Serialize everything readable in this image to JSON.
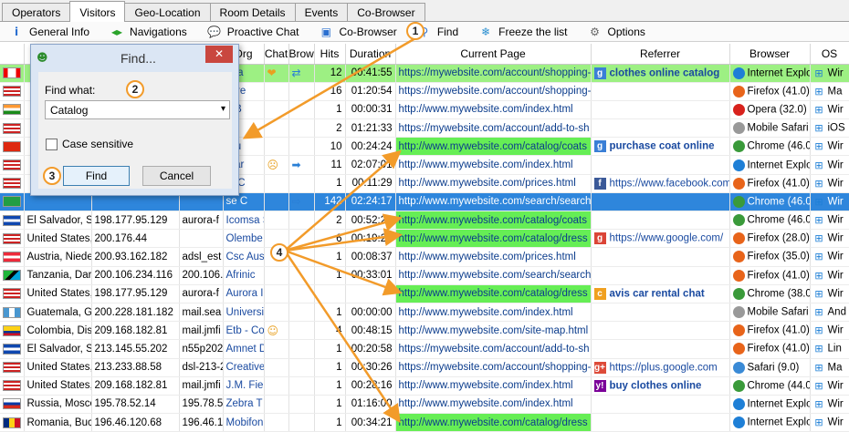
{
  "tabs": [
    "Operators",
    "Visitors",
    "Geo-Location",
    "Room Details",
    "Events",
    "Co-Browser"
  ],
  "active_tab": 1,
  "toolbar": [
    {
      "label": "General Info",
      "icon": "info-icon",
      "glyph": "i",
      "color": "#2a6fd0"
    },
    {
      "label": "Navigations",
      "icon": "navigation-arrows-icon",
      "glyph": "◂▸",
      "color": "#29a329"
    },
    {
      "label": "Proactive Chat",
      "icon": "chat-bubble-icon",
      "glyph": "💬",
      "color": "#e8a020"
    },
    {
      "label": "Co-Browser",
      "icon": "co-browser-icon",
      "glyph": "▣",
      "color": "#2a6fd0"
    },
    {
      "label": "Find",
      "icon": "magnifier-icon",
      "glyph": "⚲",
      "color": "#2a6fd0"
    },
    {
      "label": "Freeze the list",
      "icon": "snowflake-icon",
      "glyph": "❄",
      "color": "#2a8fd0"
    },
    {
      "label": "Options",
      "icon": "gear-icon",
      "glyph": "⚙",
      "color": "#666"
    }
  ],
  "columns": [
    "L",
    "IP",
    "Host",
    "Org",
    "Chat",
    "Brow",
    "Hits",
    "Duration",
    "Current Page",
    "Referrer",
    "Browser",
    "OS"
  ],
  "rows": [
    {
      "flag": "ca",
      "loc": "",
      "ip": "",
      "host": "",
      "org": "affa",
      "chat": "❤",
      "brow": "⇄",
      "hits": "12",
      "dur": "00:41:55",
      "page": "https://mywebsite.com/account/shopping-",
      "hl": false,
      "ref": "clothes online catalog",
      "refico": "g",
      "browser": "Internet Explo",
      "bcol": "#1e7fd6",
      "os": "Wir",
      "style": "green"
    },
    {
      "flag": "us",
      "loc": "",
      "ip": "",
      "host": "",
      "org": "istre",
      "chat": "",
      "brow": "",
      "hits": "16",
      "dur": "01:20:54",
      "page": "https://mywebsite.com/account/shopping-",
      "hl": false,
      "ref": "",
      "refico": "",
      "browser": "Firefox (41.0)",
      "bcol": "#e8641a",
      "os": "Ma",
      "style": ""
    },
    {
      "flag": "in",
      "loc": "",
      "ip": "",
      "host": "",
      "org": "h B",
      "chat": "",
      "brow": "",
      "hits": "1",
      "dur": "00:00:31",
      "page": "http://www.mywebsite.com/index.html",
      "hl": false,
      "ref": "",
      "refico": "",
      "browser": "Opera (32.0)",
      "bcol": "#d8221c",
      "os": "Wir",
      "style": ""
    },
    {
      "flag": "us",
      "loc": "",
      "ip": "",
      "host": "",
      "org": "I",
      "chat": "",
      "brow": "",
      "hits": "2",
      "dur": "01:21:33",
      "page": "https://mywebsite.com/account/add-to-sh",
      "hl": false,
      "ref": "",
      "refico": "",
      "browser": "Mobile Safari",
      "bcol": "#999",
      "os": "iOS",
      "style": ""
    },
    {
      "flag": "cn",
      "loc": "",
      "ip": "",
      "host": "",
      "org": "rou",
      "chat": "",
      "brow": "",
      "hits": "10",
      "dur": "00:24:24",
      "page": "http://www.mywebsite.com/catalog/coats",
      "hl": true,
      "ref": "purchase coat online",
      "refico": "g",
      "browser": "Chrome (46.0",
      "bcol": "#3a9a3a",
      "os": "Wir",
      "style": ""
    },
    {
      "flag": "us",
      "loc": "",
      "ip": "",
      "host": "",
      "org": "mar",
      "chat": "☹",
      "brow": "➡",
      "hits": "11",
      "dur": "02:07:01",
      "page": "http://www.mywebsite.com/index.html",
      "hl": false,
      "ref": "",
      "refico": "",
      "browser": "Internet Explo",
      "bcol": "#1e7fd6",
      "os": "Wir",
      "style": ""
    },
    {
      "flag": "us",
      "loc": "",
      "ip": "",
      "host": "",
      "org": "rs C",
      "chat": "",
      "brow": "",
      "hits": "1",
      "dur": "00:11:29",
      "page": "http://www.mywebsite.com/prices.html",
      "hl": false,
      "ref": "https://www.facebook.com",
      "refico": "f",
      "browser": "Firefox (41.0)",
      "bcol": "#e8641a",
      "os": "Wir",
      "style": ""
    },
    {
      "flag": "br",
      "loc": "",
      "ip": "",
      "host": "",
      "org": "se C",
      "chat": "",
      "brow": "⇨",
      "hits": "142",
      "dur": "02:24:17",
      "page": "http://www.mywebsite.com/search/search",
      "hl": false,
      "ref": "",
      "refico": "",
      "browser": "Chrome (46.0",
      "bcol": "#3a9a3a",
      "os": "Wir",
      "style": "sel"
    },
    {
      "flag": "sv",
      "loc": "El Salvador, Sa",
      "ip": "198.177.95.129",
      "host": "aurora-f",
      "org": "Icomsa S",
      "chat": "",
      "brow": "",
      "hits": "2",
      "dur": "00:52:22",
      "page": "http://www.mywebsite.com/catalog/coats",
      "hl": true,
      "ref": "",
      "refico": "",
      "browser": "Chrome (46.0",
      "bcol": "#3a9a3a",
      "os": "Wir",
      "style": ""
    },
    {
      "flag": "us",
      "loc": "United States,",
      "ip": "200.176.44",
      "host": "",
      "org": "Olembe",
      "chat": "",
      "brow": "",
      "hits": "6",
      "dur": "00:19:27",
      "page": "http://www.mywebsite.com/catalog/dress",
      "hl": true,
      "ref": "https://www.google.com/",
      "refico": "gs",
      "browser": "Firefox (28.0)",
      "bcol": "#e8641a",
      "os": "Wir",
      "style": ""
    },
    {
      "flag": "at",
      "loc": "Austria, Niede",
      "ip": "200.93.162.182",
      "host": "adsl_est",
      "org": "Csc Aus",
      "chat": "",
      "brow": "",
      "hits": "1",
      "dur": "00:08:37",
      "page": "http://www.mywebsite.com/prices.html",
      "hl": false,
      "ref": "",
      "refico": "",
      "browser": "Firefox (35.0)",
      "bcol": "#e8641a",
      "os": "Wir",
      "style": ""
    },
    {
      "flag": "tz",
      "loc": "Tanzania, Dar",
      "ip": "200.106.234.116",
      "host": "200.106.234",
      "org": "Afrinic",
      "chat": "",
      "brow": "",
      "hits": "1",
      "dur": "00:33:01",
      "page": "http://www.mywebsite.com/search/search",
      "hl": false,
      "ref": "",
      "refico": "",
      "browser": "Firefox (41.0)",
      "bcol": "#e8641a",
      "os": "Wir",
      "style": ""
    },
    {
      "flag": "us",
      "loc": "United States,",
      "ip": "198.177.95.129",
      "host": "aurora-f",
      "org": "Aurora I",
      "chat": "",
      "brow": "",
      "hits": "",
      "dur": "",
      "page": "http://www.mywebsite.com/catalog/dress",
      "hl": true,
      "ref": "avis car rental chat",
      "refico": "c",
      "browser": "Chrome (38.0",
      "bcol": "#3a9a3a",
      "os": "Wir",
      "style": ""
    },
    {
      "flag": "gt",
      "loc": "Guatemala, Gu",
      "ip": "200.228.181.182",
      "host": "mail.sea",
      "org": "Universi",
      "chat": "",
      "brow": "",
      "hits": "1",
      "dur": "00:00:00",
      "page": "http://www.mywebsite.com/index.html",
      "hl": false,
      "ref": "",
      "refico": "",
      "browser": "Mobile Safari",
      "bcol": "#999",
      "os": "And",
      "style": ""
    },
    {
      "flag": "co",
      "loc": "Colombia, Dist",
      "ip": "209.168.182.81",
      "host": "mail.jmfi",
      "org": "Etb - Co",
      "chat": "☺",
      "brow": "",
      "hits": "4",
      "dur": "00:48:15",
      "page": "http://www.mywebsite.com/site-map.html",
      "hl": false,
      "ref": "",
      "refico": "",
      "browser": "Firefox (41.0)",
      "bcol": "#e8641a",
      "os": "Wir",
      "style": ""
    },
    {
      "flag": "sv",
      "loc": "El Salvador, Sa",
      "ip": "213.145.55.202",
      "host": "n55p202",
      "org": "Amnet D",
      "chat": "",
      "brow": "",
      "hits": "1",
      "dur": "00:20:58",
      "page": "https://mywebsite.com/account/add-to-sh",
      "hl": false,
      "ref": "",
      "refico": "",
      "browser": "Firefox (41.0)",
      "bcol": "#e8641a",
      "os": "Lin",
      "style": ""
    },
    {
      "flag": "us",
      "loc": "United States,",
      "ip": "213.233.88.58",
      "host": "dsl-213-2",
      "org": "Creative",
      "chat": "",
      "brow": "",
      "hits": "1",
      "dur": "00:30:26",
      "page": "https://mywebsite.com/account/shopping-",
      "hl": false,
      "ref": "https://plus.google.com",
      "refico": "g+",
      "browser": "Safari (9.0)",
      "bcol": "#3a8ad6",
      "os": "Ma",
      "style": ""
    },
    {
      "flag": "us",
      "loc": "United States,",
      "ip": "209.168.182.81",
      "host": "mail.jmfi",
      "org": "J.M. Fie",
      "chat": "",
      "brow": "",
      "hits": "1",
      "dur": "00:28:16",
      "page": "http://www.mywebsite.com/index.html",
      "hl": false,
      "ref": "buy clothes online",
      "refico": "y",
      "browser": "Chrome (44.0",
      "bcol": "#3a9a3a",
      "os": "Wir",
      "style": ""
    },
    {
      "flag": "ru",
      "loc": "Russia, Mosco",
      "ip": "195.78.52.14",
      "host": "195.78.5",
      "org": "Zebra T",
      "chat": "",
      "brow": "",
      "hits": "1",
      "dur": "01:16:00",
      "page": "http://www.mywebsite.com/index.html",
      "hl": false,
      "ref": "",
      "refico": "",
      "browser": "Internet Explo",
      "bcol": "#1e7fd6",
      "os": "Wir",
      "style": ""
    },
    {
      "flag": "ro",
      "loc": "Romania, Bucu",
      "ip": "196.46.120.68",
      "host": "196.46.1",
      "org": "Mobifon",
      "chat": "",
      "brow": "",
      "hits": "1",
      "dur": "00:34:21",
      "page": "http://www.mywebsite.com/catalog/dress",
      "hl": true,
      "ref": "",
      "refico": "",
      "browser": "Internet Explo",
      "bcol": "#1e7fd6",
      "os": "Wir",
      "style": ""
    }
  ],
  "find_dialog": {
    "title": "Find...",
    "find_what_label": "Find what:",
    "value": "Catalog",
    "case_label": "Case sensitive",
    "find_button": "Find",
    "cancel_button": "Cancel"
  },
  "callouts": [
    "1",
    "2",
    "3",
    "4"
  ]
}
